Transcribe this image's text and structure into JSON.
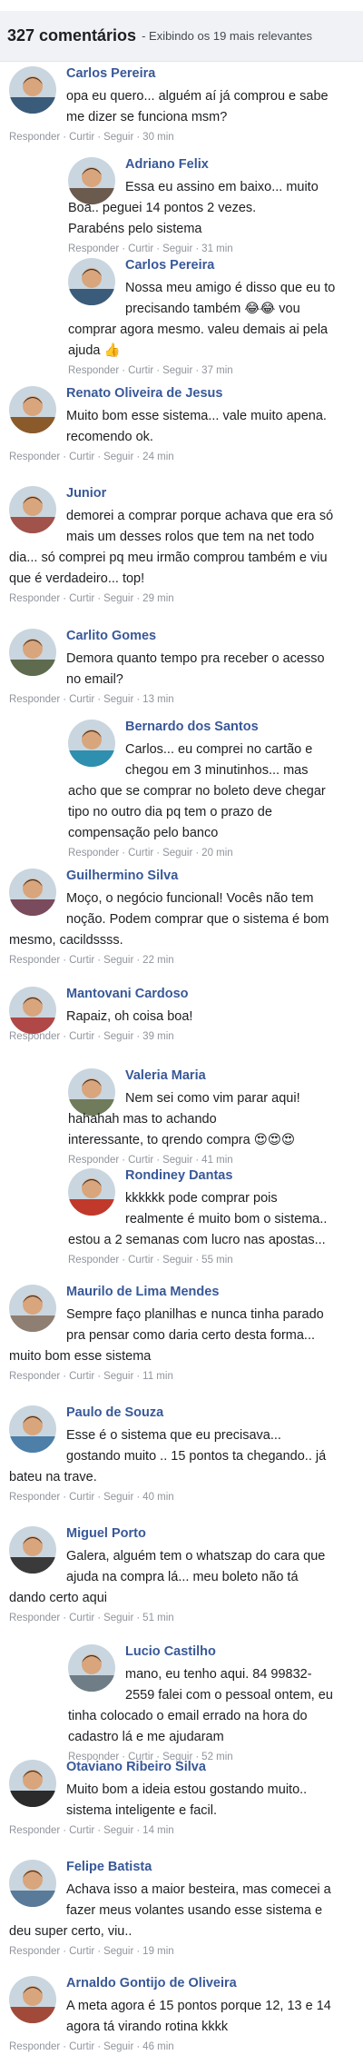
{
  "header": {
    "count": "327 comentários",
    "subtitle": "- Exibindo os 19 mais relevantes"
  },
  "meta_labels": {
    "reply": "Responder",
    "like": "Curtir",
    "follow": "Seguir"
  },
  "comments": [
    {
      "author": "Carlos Pereira",
      "lines": [
        "opa eu quero... alguém aí já comprou e sabe",
        "me dizer se funciona msm?"
      ],
      "time": "30 min",
      "avatar_color": "#3b5b7a"
    },
    {
      "author": "Adriano Felix",
      "lines": [
        "Essa eu assino em baixo... muito",
        "Boa.. peguei 14 pontos 2 vezes.",
        "Parabéns pelo sistema"
      ],
      "time": "31 min",
      "avatar_color": "#6b5a4e"
    },
    {
      "author": "Carlos Pereira",
      "lines": [
        "Nossa meu amigo é disso que eu to",
        "precisando também 😂😂 vou",
        "comprar agora mesmo. valeu demais ai pela",
        "ajuda 👍"
      ],
      "time": "37 min",
      "avatar_color": "#3b5b7a"
    },
    {
      "author": "Renato Oliveira de Jesus",
      "lines": [
        "Muito bom esse sistema... vale muito apena.",
        "recomendo ok."
      ],
      "time": "24 min",
      "avatar_color": "#8a5a2b"
    },
    {
      "author": "Junior",
      "lines": [
        "demorei a comprar porque achava que era só",
        "mais um desses rolos que tem na net todo",
        "dia... só comprei pq meu irmão comprou também e viu",
        "que é verdadeiro... top!"
      ],
      "time": "29 min",
      "avatar_color": "#a0524b"
    },
    {
      "author": "Carlito Gomes",
      "lines": [
        "Demora quanto tempo pra receber o acesso",
        "no email?"
      ],
      "time": "13 min",
      "avatar_color": "#5e6b4f"
    },
    {
      "author": "Bernardo dos Santos",
      "lines": [
        "Carlos... eu comprei no cartão e",
        "chegou em 3 minutinhos... mas",
        "acho que se comprar no boleto deve chegar",
        "tipo no outro dia pq tem o prazo de",
        "compensação pelo banco"
      ],
      "time": "20 min",
      "avatar_color": "#2f8fae"
    },
    {
      "author": "Guilhermino Silva",
      "lines": [
        "Moço, o negócio funcional! Vocês não tem",
        "noção. Podem comprar que o sistema é bom",
        "mesmo, cacildssss."
      ],
      "time": "22 min",
      "avatar_color": "#7a4b5c"
    },
    {
      "author": "Mantovani Cardoso",
      "lines": [
        "Rapaiz, oh coisa boa!"
      ],
      "time": "39 min",
      "avatar_color": "#b04848"
    },
    {
      "author": "Valeria Maria",
      "lines": [
        "Nem sei como vim parar aqui!",
        "hahahah mas to achando",
        "interessante, to qrendo compra 😍😍😍"
      ],
      "time": "41 min",
      "avatar_color": "#6f7b5a"
    },
    {
      "author": "Rondiney Dantas",
      "lines": [
        "kkkkkk pode comprar pois",
        "realmente é muito bom o sistema..",
        "estou a 2 semanas com lucro nas apostas..."
      ],
      "time": "55 min",
      "avatar_color": "#c0392b"
    },
    {
      "author": "Maurilo de Lima Mendes",
      "lines": [
        "Sempre faço planilhas e nunca tinha parado",
        "pra pensar como daria certo desta forma...",
        "muito bom esse sistema"
      ],
      "time": "11 min",
      "avatar_color": "#8f7f72"
    },
    {
      "author": "Paulo de Souza",
      "lines": [
        "Esse é o sistema que eu precisava...",
        "gostando muito .. 15 pontos ta chegando.. já",
        "bateu na trave."
      ],
      "time": "40 min",
      "avatar_color": "#4d7fa8"
    },
    {
      "author": "Miguel Porto",
      "lines": [
        "Galera, alguém tem o whatszap do cara que",
        "ajuda na compra lá... meu boleto não tá",
        "dando certo aqui"
      ],
      "time": "51 min",
      "avatar_color": "#3a3a3a"
    },
    {
      "author": "Lucio Castilho",
      "lines": [
        "mano, eu tenho aqui. 84 99832-",
        "2559 falei com o pessoal ontem, eu",
        "tinha colocado o email errado na hora do",
        "cadastro lá e me ajudaram"
      ],
      "time": "52 min",
      "avatar_color": "#6e7d86"
    },
    {
      "author": "Otaviano Ribeiro Silva",
      "lines": [
        "Muito bom a ideia estou gostando muito..",
        "sistema inteligente e facil."
      ],
      "time": "14 min",
      "avatar_color": "#2b2b2b"
    },
    {
      "author": "Felipe Batista",
      "lines": [
        "Achava isso a maior besteira, mas comecei a",
        "fazer meus volantes usando esse sistema e",
        "deu super certo, viu.."
      ],
      "time": "19 min",
      "avatar_color": "#5a7a9a"
    },
    {
      "author": "Arnaldo Gontijo de Oliveira",
      "lines": [
        "A meta agora é 15 pontos porque 12, 13 e 14",
        "agora tá virando rotina kkkk"
      ],
      "time": "46 min",
      "avatar_color": "#a24a3a"
    }
  ]
}
